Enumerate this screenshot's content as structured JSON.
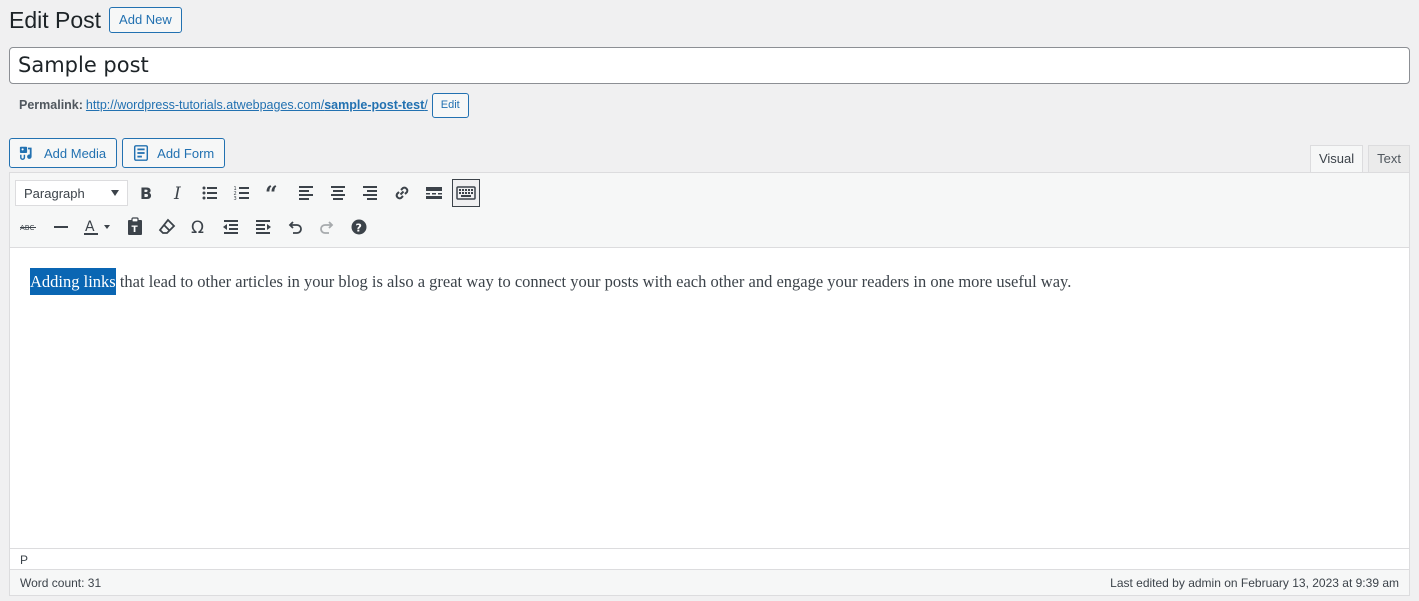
{
  "header": {
    "title": "Edit Post",
    "add_new_label": "Add New"
  },
  "post": {
    "title": "Sample post"
  },
  "permalink": {
    "label": "Permalink:",
    "url_base": "http://wordpress-tutorials.atwebpages.com/",
    "url_slug": "sample-post-test",
    "url_trailing": "/",
    "edit_label": "Edit"
  },
  "media_buttons": {
    "add_media": "Add Media",
    "add_form": "Add Form"
  },
  "tabs": {
    "visual": "Visual",
    "text": "Text",
    "active": "Visual"
  },
  "toolbar": {
    "format_value": "Paragraph",
    "row1_icons": [
      "bold-icon",
      "italic-icon",
      "bulleted-list-icon",
      "numbered-list-icon",
      "blockquote-icon",
      "align-left-icon",
      "align-center-icon",
      "align-right-icon",
      "insert-link-icon",
      "read-more-icon",
      "toolbar-toggle-icon"
    ],
    "row2_icons": [
      "strikethrough-icon",
      "horizontal-line-icon",
      "text-color-icon",
      "paste-as-text-icon",
      "clear-formatting-icon",
      "special-character-icon",
      "outdent-icon",
      "indent-icon",
      "undo-icon",
      "redo-icon",
      "help-icon"
    ]
  },
  "content": {
    "selected_text": "Adding links",
    "rest_text": " that lead to other articles in your blog is also a great way to connect your posts with each other and engage your readers in one more useful way."
  },
  "path_bar": {
    "path": "P"
  },
  "status": {
    "word_count": "Word count: 31",
    "last_edited": "Last edited by admin on February 13, 2023 at 9:39 am"
  },
  "colors": {
    "accent": "#2271b1",
    "selection": "#0a66b3",
    "toolbar_bg": "#f6f7f7",
    "page_bg": "#f0f0f1"
  }
}
